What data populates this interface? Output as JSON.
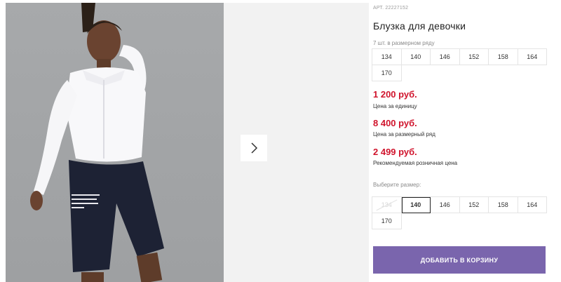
{
  "product": {
    "article": "АРТ. 22227152",
    "title": "Блузка для девочки",
    "row_note": "7 шт. в размерном ряду",
    "row_sizes": [
      "134",
      "140",
      "146",
      "152",
      "158",
      "164",
      "170"
    ]
  },
  "prices": [
    {
      "amount": "1 200 руб.",
      "label": "Цена за единицу"
    },
    {
      "amount": "8 400 руб.",
      "label": "Цена за размерный ряд"
    },
    {
      "amount": "2 499 руб.",
      "label": "Рекомендуемая розничная цена"
    }
  ],
  "size_picker": {
    "label": "Выберите размер:",
    "options": [
      "134",
      "140",
      "146",
      "152",
      "158",
      "164",
      "170"
    ],
    "selected": "140",
    "unavailable": [
      "134"
    ]
  },
  "cart": {
    "button_label": "ДОБАВИТЬ В КОРЗИНУ"
  },
  "colors": {
    "price": "#d0142c",
    "button": "#7a65ad",
    "photo_bg": "#a4a6a8",
    "next_panel": "#f2f2f2"
  },
  "icons": {
    "next": "chevron-right-icon"
  },
  "photo": {
    "shorts_print": "TRY ALWAYS WHO HERE ANOTHER ONE BIRTHDAY STORY BE NEW 8"
  }
}
